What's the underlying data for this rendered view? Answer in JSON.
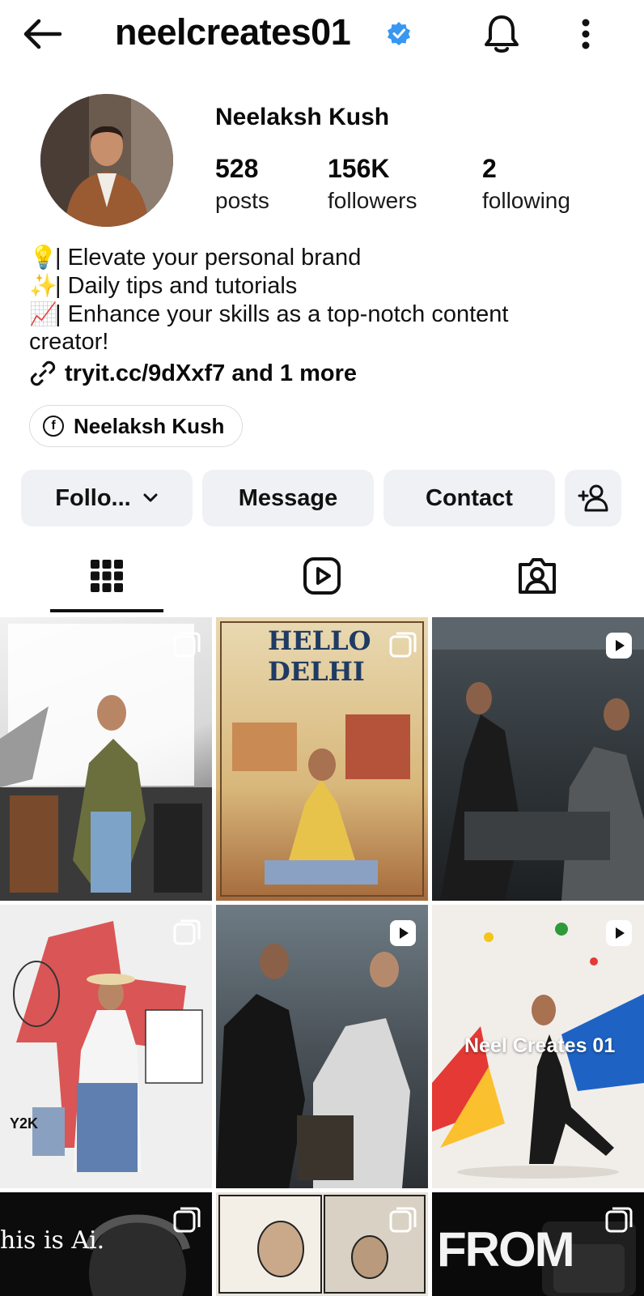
{
  "header": {
    "username": "neelcreates01",
    "icons": {
      "back": "arrow-left-icon",
      "verified": "verified-badge-icon",
      "bell": "bell-icon",
      "more": "more-vertical-icon"
    }
  },
  "profile": {
    "display_name": "Neelaksh Kush",
    "stats": [
      {
        "count": "528",
        "label": "posts"
      },
      {
        "count": "156K",
        "label": "followers"
      },
      {
        "count": "2",
        "label": "following"
      }
    ],
    "bio": [
      {
        "emoji": "💡",
        "text": "| Elevate your personal brand"
      },
      {
        "emoji": "✨",
        "text": "| Daily tips and tutorials"
      },
      {
        "emoji": "📈",
        "text": "| Enhance your skills as a top-notch content"
      },
      {
        "emoji": "",
        "text": "creator!"
      }
    ],
    "link": "tryit.cc/9dXxf7 and 1 more",
    "facebook_chip": "Neelaksh Kush"
  },
  "actions": {
    "following": "Follo...",
    "message": "Message",
    "contact": "Contact"
  },
  "tabs": [
    {
      "icon": "grid-icon"
    },
    {
      "icon": "reels-icon"
    },
    {
      "icon": "tagged-icon"
    }
  ],
  "grid": {
    "tiles": [
      {
        "kind": "carousel",
        "text": ""
      },
      {
        "kind": "carousel",
        "text": "HELLO DELHI"
      },
      {
        "kind": "reel",
        "text": ""
      },
      {
        "kind": "carousel",
        "text": "Y2K"
      },
      {
        "kind": "reel",
        "text": ""
      },
      {
        "kind": "reel",
        "text": "Neel Creates 01"
      },
      {
        "kind": "carousel",
        "text": "his is Ai."
      },
      {
        "kind": "carousel",
        "text": ""
      },
      {
        "kind": "carousel",
        "text": "FROM"
      }
    ],
    "colors": {
      "accent_verified": "#3897f0",
      "button_bg": "#eff1f4"
    }
  }
}
